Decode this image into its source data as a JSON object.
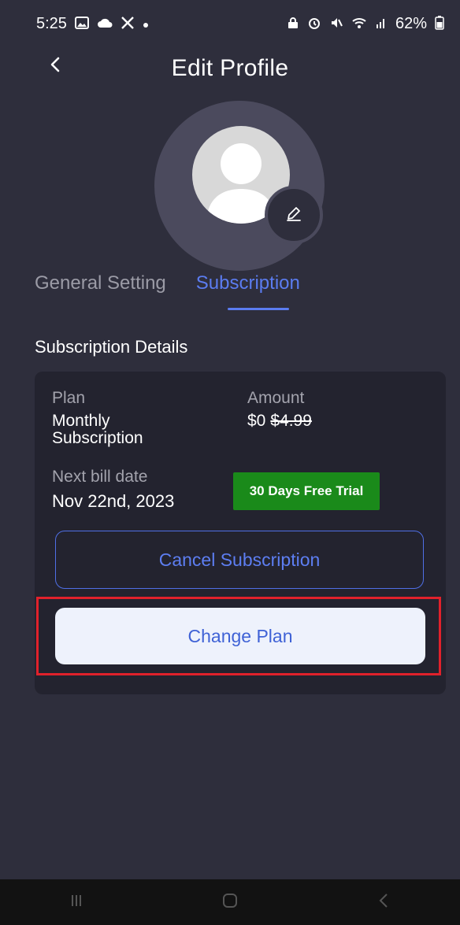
{
  "status_bar": {
    "time": "5:25",
    "left_icons": [
      "image-icon",
      "cloud-icon",
      "x-logo-icon",
      "dot-icon"
    ],
    "right_icons": [
      "lock-icon",
      "alarm-icon",
      "mute-icon",
      "wifi-icon",
      "signal-icon"
    ],
    "battery": "62%"
  },
  "header": {
    "title": "Edit Profile",
    "back_icon": "chevron-left-icon"
  },
  "avatar": {
    "icon": "user-icon",
    "edit_icon": "pencil-icon"
  },
  "tabs": [
    {
      "label": "General Setting",
      "active": false
    },
    {
      "label": "Subscription",
      "active": true
    }
  ],
  "subscription": {
    "section_title": "Subscription Details",
    "plan_label": "Plan",
    "plan_value_line1": "Monthly",
    "plan_value_line2": "Subscription",
    "amount_label": "Amount",
    "amount_price": "$0",
    "amount_original": "$4.99",
    "next_bill_label": "Next bill date",
    "next_bill_value": "Nov 22nd, 2023",
    "trial_badge": "30 Days Free Trial",
    "cancel_button": "Cancel Subscription",
    "change_button": "Change Plan"
  },
  "colors": {
    "background": "#2e2e3c",
    "accent": "#5b7cf0",
    "trial_green": "#1a8a1a",
    "highlight_red": "#e0212b"
  },
  "nav_bar": {
    "icons": [
      "recent-apps-icon",
      "home-icon",
      "back-icon"
    ]
  }
}
